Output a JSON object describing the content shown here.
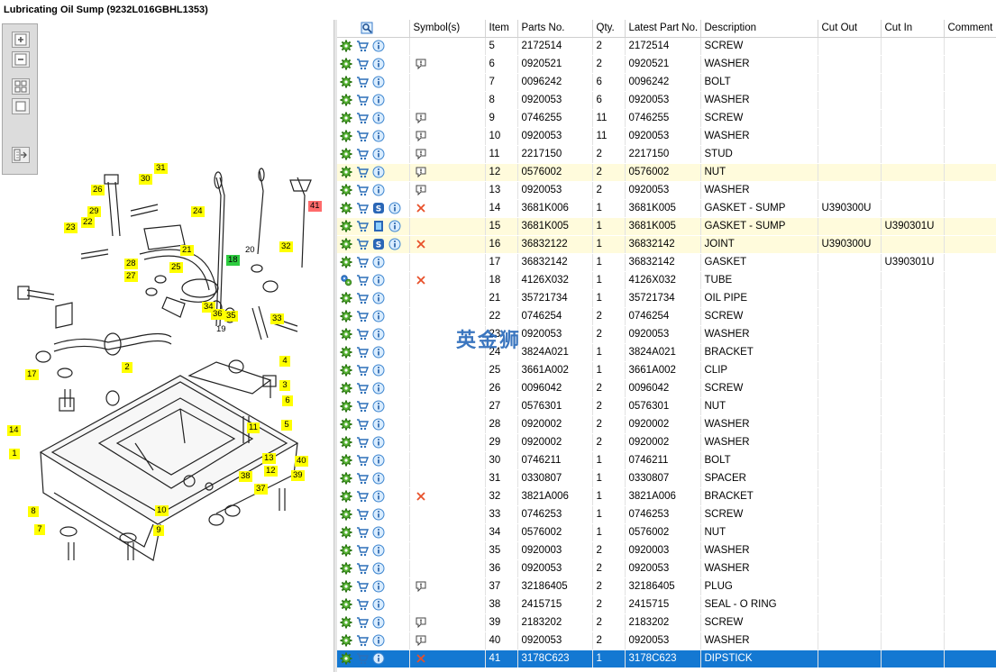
{
  "window": {
    "title": "Lubricating Oil Sump (9232L016GBHL1353)"
  },
  "toolbox": {
    "buttons": [
      {
        "name": "zoom-in-button",
        "icon": "zoom-in-icon"
      },
      {
        "name": "zoom-out-button",
        "icon": "zoom-out-icon"
      },
      {
        "name": "fit-all-button",
        "icon": "fit-all-icon"
      },
      {
        "name": "zoom-window-button",
        "icon": "zoom-window-icon"
      },
      {
        "name": "print-export-button",
        "icon": "export-icon"
      }
    ]
  },
  "drawing": {
    "callouts": [
      {
        "label": "31",
        "style": "yellow"
      },
      {
        "label": "30",
        "style": "yellow"
      },
      {
        "label": "26",
        "style": "yellow"
      },
      {
        "label": "29",
        "style": "yellow"
      },
      {
        "label": "24",
        "style": "yellow"
      },
      {
        "label": "22",
        "style": "yellow"
      },
      {
        "label": "23",
        "style": "yellow"
      },
      {
        "label": "21",
        "style": "yellow"
      },
      {
        "label": "28",
        "style": "yellow"
      },
      {
        "label": "25",
        "style": "yellow"
      },
      {
        "label": "27",
        "style": "yellow"
      },
      {
        "label": "20",
        "style": "plain"
      },
      {
        "label": "32",
        "style": "yellow"
      },
      {
        "label": "18",
        "style": "green"
      },
      {
        "label": "41",
        "style": "red"
      },
      {
        "label": "34",
        "style": "yellow"
      },
      {
        "label": "36",
        "style": "yellow"
      },
      {
        "label": "35",
        "style": "yellow"
      },
      {
        "label": "33",
        "style": "yellow"
      },
      {
        "label": "19",
        "style": "plain"
      },
      {
        "label": "4",
        "style": "yellow"
      },
      {
        "label": "2",
        "style": "yellow"
      },
      {
        "label": "17",
        "style": "yellow"
      },
      {
        "label": "3",
        "style": "yellow"
      },
      {
        "label": "6",
        "style": "yellow"
      },
      {
        "label": "14",
        "style": "yellow"
      },
      {
        "label": "5",
        "style": "yellow"
      },
      {
        "label": "11",
        "style": "yellow"
      },
      {
        "label": "1",
        "style": "yellow"
      },
      {
        "label": "13",
        "style": "yellow"
      },
      {
        "label": "40",
        "style": "yellow"
      },
      {
        "label": "12",
        "style": "yellow"
      },
      {
        "label": "39",
        "style": "yellow"
      },
      {
        "label": "38",
        "style": "yellow"
      },
      {
        "label": "37",
        "style": "yellow"
      },
      {
        "label": "8",
        "style": "yellow"
      },
      {
        "label": "10",
        "style": "yellow"
      },
      {
        "label": "7",
        "style": "yellow"
      },
      {
        "label": "9",
        "style": "yellow"
      }
    ]
  },
  "table": {
    "columns": [
      "",
      "Symbol(s)",
      "Item",
      "Parts No.",
      "Qty.",
      "Latest Part No.",
      "Description",
      "Cut Out",
      "Cut In",
      "Comment"
    ],
    "rows": [
      {
        "icons": [
          "gear",
          "cart",
          "info"
        ],
        "symbol": "",
        "item": "5",
        "parts_no": "2172514",
        "qty": "2",
        "latest": "2172514",
        "desc": "SCREW",
        "cut_out": "",
        "cut_in": "",
        "comment": "",
        "state": ""
      },
      {
        "icons": [
          "gear",
          "cart",
          "info"
        ],
        "symbol": "bubble",
        "item": "6",
        "parts_no": "0920521",
        "qty": "2",
        "latest": "0920521",
        "desc": "WASHER",
        "cut_out": "",
        "cut_in": "",
        "comment": "",
        "state": ""
      },
      {
        "icons": [
          "gear",
          "cart",
          "info"
        ],
        "symbol": "",
        "item": "7",
        "parts_no": "0096242",
        "qty": "6",
        "latest": "0096242",
        "desc": "BOLT",
        "cut_out": "",
        "cut_in": "",
        "comment": "",
        "state": ""
      },
      {
        "icons": [
          "gear",
          "cart",
          "info"
        ],
        "symbol": "",
        "item": "8",
        "parts_no": "0920053",
        "qty": "6",
        "latest": "0920053",
        "desc": "WASHER",
        "cut_out": "",
        "cut_in": "",
        "comment": "",
        "state": ""
      },
      {
        "icons": [
          "gear",
          "cart",
          "info"
        ],
        "symbol": "bubble",
        "item": "9",
        "parts_no": "0746255",
        "qty": "11",
        "latest": "0746255",
        "desc": "SCREW",
        "cut_out": "",
        "cut_in": "",
        "comment": "",
        "state": ""
      },
      {
        "icons": [
          "gear",
          "cart",
          "info"
        ],
        "symbol": "bubble",
        "item": "10",
        "parts_no": "0920053",
        "qty": "11",
        "latest": "0920053",
        "desc": "WASHER",
        "cut_out": "",
        "cut_in": "",
        "comment": "",
        "state": ""
      },
      {
        "icons": [
          "gear",
          "cart",
          "info"
        ],
        "symbol": "bubble",
        "item": "11",
        "parts_no": "2217150",
        "qty": "2",
        "latest": "2217150",
        "desc": "STUD",
        "cut_out": "",
        "cut_in": "",
        "comment": "",
        "state": ""
      },
      {
        "icons": [
          "gear",
          "cart",
          "info"
        ],
        "symbol": "bubble",
        "item": "12",
        "parts_no": "0576002",
        "qty": "2",
        "latest": "0576002",
        "desc": "NUT",
        "cut_out": "",
        "cut_in": "",
        "comment": "",
        "state": "hl"
      },
      {
        "icons": [
          "gear",
          "cart",
          "info"
        ],
        "symbol": "bubble",
        "item": "13",
        "parts_no": "0920053",
        "qty": "2",
        "latest": "0920053",
        "desc": "WASHER",
        "cut_out": "",
        "cut_in": "",
        "comment": "",
        "state": ""
      },
      {
        "icons": [
          "gear",
          "cart",
          "s",
          "info"
        ],
        "symbol": "x",
        "item": "14",
        "parts_no": "3681K006",
        "qty": "1",
        "latest": "3681K005",
        "desc": "GASKET - SUMP",
        "cut_out": "U390300U",
        "cut_in": "",
        "comment": "",
        "state": ""
      },
      {
        "icons": [
          "gear",
          "cart",
          "book",
          "info"
        ],
        "symbol": "",
        "item": "15",
        "parts_no": "3681K005",
        "qty": "1",
        "latest": "3681K005",
        "desc": "GASKET - SUMP",
        "cut_out": "",
        "cut_in": "U390301U",
        "comment": "",
        "state": "hl"
      },
      {
        "icons": [
          "gear",
          "cart",
          "s",
          "info"
        ],
        "symbol": "x",
        "item": "16",
        "parts_no": "36832122",
        "qty": "1",
        "latest": "36832142",
        "desc": "JOINT",
        "cut_out": "U390300U",
        "cut_in": "",
        "comment": "",
        "state": "hl"
      },
      {
        "icons": [
          "gear",
          "cart",
          "info"
        ],
        "symbol": "",
        "item": "17",
        "parts_no": "36832142",
        "qty": "1",
        "latest": "36832142",
        "desc": "GASKET",
        "cut_out": "",
        "cut_in": "U390301U",
        "comment": "",
        "state": ""
      },
      {
        "icons": [
          "gears",
          "cart",
          "info"
        ],
        "symbol": "x",
        "item": "18",
        "parts_no": "4126X032",
        "qty": "1",
        "latest": "4126X032",
        "desc": "TUBE",
        "cut_out": "",
        "cut_in": "",
        "comment": "",
        "state": ""
      },
      {
        "icons": [
          "gear",
          "cart",
          "info"
        ],
        "symbol": "",
        "item": "21",
        "parts_no": "35721734",
        "qty": "1",
        "latest": "35721734",
        "desc": "OIL PIPE",
        "cut_out": "",
        "cut_in": "",
        "comment": "",
        "state": ""
      },
      {
        "icons": [
          "gear",
          "cart",
          "info"
        ],
        "symbol": "",
        "item": "22",
        "parts_no": "0746254",
        "qty": "2",
        "latest": "0746254",
        "desc": "SCREW",
        "cut_out": "",
        "cut_in": "",
        "comment": "",
        "state": ""
      },
      {
        "icons": [
          "gear",
          "cart",
          "info"
        ],
        "symbol": "",
        "item": "23",
        "parts_no": "0920053",
        "qty": "2",
        "latest": "0920053",
        "desc": "WASHER",
        "cut_out": "",
        "cut_in": "",
        "comment": "",
        "state": ""
      },
      {
        "icons": [
          "gear",
          "cart",
          "info"
        ],
        "symbol": "",
        "item": "24",
        "parts_no": "3824A021",
        "qty": "1",
        "latest": "3824A021",
        "desc": "BRACKET",
        "cut_out": "",
        "cut_in": "",
        "comment": "",
        "state": ""
      },
      {
        "icons": [
          "gear",
          "cart",
          "info"
        ],
        "symbol": "",
        "item": "25",
        "parts_no": "3661A002",
        "qty": "1",
        "latest": "3661A002",
        "desc": "CLIP",
        "cut_out": "",
        "cut_in": "",
        "comment": "",
        "state": ""
      },
      {
        "icons": [
          "gear",
          "cart",
          "info"
        ],
        "symbol": "",
        "item": "26",
        "parts_no": "0096042",
        "qty": "2",
        "latest": "0096042",
        "desc": "SCREW",
        "cut_out": "",
        "cut_in": "",
        "comment": "",
        "state": ""
      },
      {
        "icons": [
          "gear",
          "cart",
          "info"
        ],
        "symbol": "",
        "item": "27",
        "parts_no": "0576301",
        "qty": "2",
        "latest": "0576301",
        "desc": "NUT",
        "cut_out": "",
        "cut_in": "",
        "comment": "",
        "state": ""
      },
      {
        "icons": [
          "gear",
          "cart",
          "info"
        ],
        "symbol": "",
        "item": "28",
        "parts_no": "0920002",
        "qty": "2",
        "latest": "0920002",
        "desc": "WASHER",
        "cut_out": "",
        "cut_in": "",
        "comment": "",
        "state": ""
      },
      {
        "icons": [
          "gear",
          "cart",
          "info"
        ],
        "symbol": "",
        "item": "29",
        "parts_no": "0920002",
        "qty": "2",
        "latest": "0920002",
        "desc": "WASHER",
        "cut_out": "",
        "cut_in": "",
        "comment": "",
        "state": ""
      },
      {
        "icons": [
          "gear",
          "cart",
          "info"
        ],
        "symbol": "",
        "item": "30",
        "parts_no": "0746211",
        "qty": "1",
        "latest": "0746211",
        "desc": "BOLT",
        "cut_out": "",
        "cut_in": "",
        "comment": "",
        "state": ""
      },
      {
        "icons": [
          "gear",
          "cart",
          "info"
        ],
        "symbol": "",
        "item": "31",
        "parts_no": "0330807",
        "qty": "1",
        "latest": "0330807",
        "desc": "SPACER",
        "cut_out": "",
        "cut_in": "",
        "comment": "",
        "state": ""
      },
      {
        "icons": [
          "gear",
          "cart",
          "info"
        ],
        "symbol": "x",
        "item": "32",
        "parts_no": "3821A006",
        "qty": "1",
        "latest": "3821A006",
        "desc": "BRACKET",
        "cut_out": "",
        "cut_in": "",
        "comment": "",
        "state": ""
      },
      {
        "icons": [
          "gear",
          "cart",
          "info"
        ],
        "symbol": "",
        "item": "33",
        "parts_no": "0746253",
        "qty": "1",
        "latest": "0746253",
        "desc": "SCREW",
        "cut_out": "",
        "cut_in": "",
        "comment": "",
        "state": ""
      },
      {
        "icons": [
          "gear",
          "cart",
          "info"
        ],
        "symbol": "",
        "item": "34",
        "parts_no": "0576002",
        "qty": "1",
        "latest": "0576002",
        "desc": "NUT",
        "cut_out": "",
        "cut_in": "",
        "comment": "",
        "state": ""
      },
      {
        "icons": [
          "gear",
          "cart",
          "info"
        ],
        "symbol": "",
        "item": "35",
        "parts_no": "0920003",
        "qty": "2",
        "latest": "0920003",
        "desc": "WASHER",
        "cut_out": "",
        "cut_in": "",
        "comment": "",
        "state": ""
      },
      {
        "icons": [
          "gear",
          "cart",
          "info"
        ],
        "symbol": "",
        "item": "36",
        "parts_no": "0920053",
        "qty": "2",
        "latest": "0920053",
        "desc": "WASHER",
        "cut_out": "",
        "cut_in": "",
        "comment": "",
        "state": ""
      },
      {
        "icons": [
          "gear",
          "cart",
          "info"
        ],
        "symbol": "bubble",
        "item": "37",
        "parts_no": "32186405",
        "qty": "2",
        "latest": "32186405",
        "desc": "PLUG",
        "cut_out": "",
        "cut_in": "",
        "comment": "",
        "state": ""
      },
      {
        "icons": [
          "gear",
          "cart",
          "info"
        ],
        "symbol": "",
        "item": "38",
        "parts_no": "2415715",
        "qty": "2",
        "latest": "2415715",
        "desc": "SEAL - O RING",
        "cut_out": "",
        "cut_in": "",
        "comment": "",
        "state": ""
      },
      {
        "icons": [
          "gear",
          "cart",
          "info"
        ],
        "symbol": "bubble",
        "item": "39",
        "parts_no": "2183202",
        "qty": "2",
        "latest": "2183202",
        "desc": "SCREW",
        "cut_out": "",
        "cut_in": "",
        "comment": "",
        "state": ""
      },
      {
        "icons": [
          "gear",
          "cart",
          "info"
        ],
        "symbol": "bubble",
        "item": "40",
        "parts_no": "0920053",
        "qty": "2",
        "latest": "0920053",
        "desc": "WASHER",
        "cut_out": "",
        "cut_in": "",
        "comment": "",
        "state": ""
      },
      {
        "icons": [
          "gear",
          "cart",
          "info"
        ],
        "symbol": "x",
        "item": "41",
        "parts_no": "3178C623",
        "qty": "1",
        "latest": "3178C623",
        "desc": "DIPSTICK",
        "cut_out": "",
        "cut_in": "",
        "comment": "",
        "state": "sel"
      }
    ]
  },
  "watermark": {
    "text": "英金狮"
  },
  "colors": {
    "selected_row": "#1478d2",
    "highlight_row": "#fffbdc",
    "callout": "#ffff00",
    "callout_green": "#2ecc40",
    "callout_red": "#ff6b6b",
    "x_mark": "#e8502a"
  }
}
